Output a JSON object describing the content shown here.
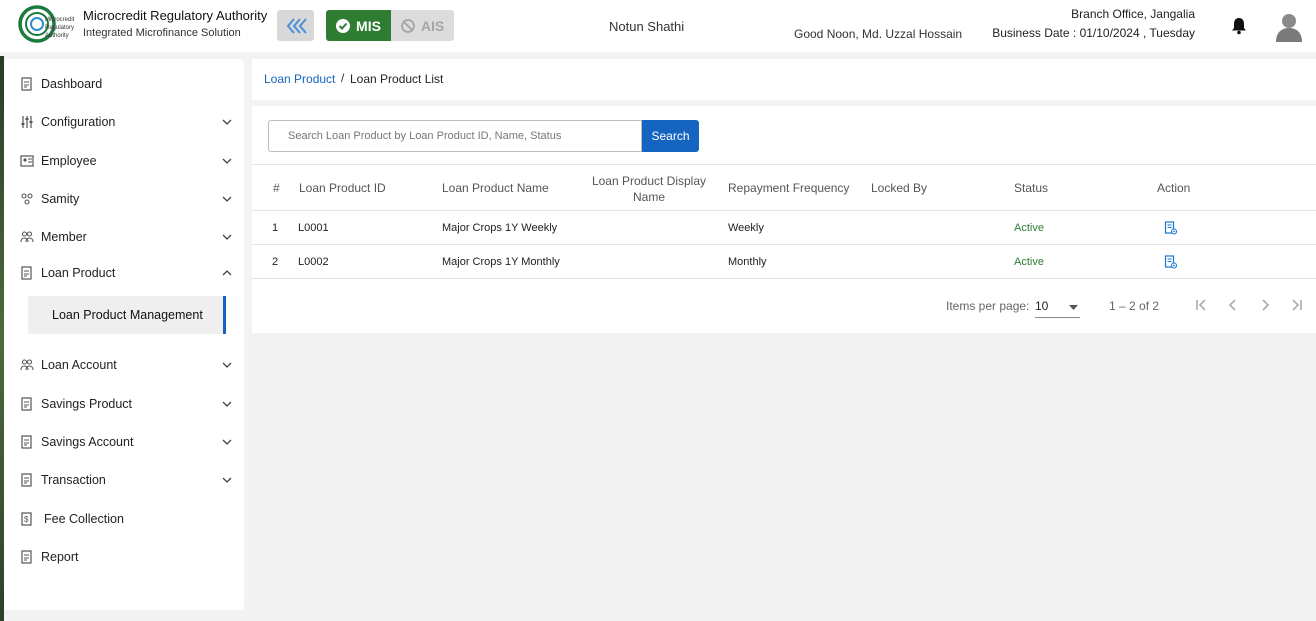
{
  "header": {
    "org_title": "Microcredit Regulatory Authority",
    "org_subtitle": "Integrated Microfinance Solution",
    "logo_text": "Microcredit Regulatory Authority",
    "mode_mis": "MIS",
    "mode_ais": "AIS",
    "center_title": "Notun Shathi",
    "greeting": "Good Noon, Md. Uzzal Hossain",
    "branch": "Branch Office, Jangalia",
    "business_date": "Business Date : 01/10/2024 , Tuesday",
    "accent_color": "#1565c0",
    "mis_color": "#2e7d32"
  },
  "sidebar": {
    "items": [
      {
        "label": "Dashboard",
        "icon": "document-icon"
      },
      {
        "label": "Configuration",
        "icon": "sliders-icon"
      },
      {
        "label": "Employee",
        "icon": "id-card-icon"
      },
      {
        "label": "Samity",
        "icon": "group-icon"
      },
      {
        "label": "Member",
        "icon": "users-icon"
      },
      {
        "label": "Loan Product",
        "icon": "document-icon"
      },
      {
        "label": "Loan Account",
        "icon": "users-icon"
      },
      {
        "label": "Savings Product",
        "icon": "document-icon"
      },
      {
        "label": "Savings Account",
        "icon": "document-icon"
      },
      {
        "label": "Transaction",
        "icon": "document-icon"
      },
      {
        "label": "Fee Collection",
        "icon": "fee-icon"
      },
      {
        "label": "Report",
        "icon": "document-icon"
      }
    ],
    "sub_item": "Loan Product Management"
  },
  "breadcrumb": {
    "parent": "Loan Product",
    "separator": "/",
    "current": "Loan Product List"
  },
  "search": {
    "placeholder": "Search Loan Product by Loan Product ID, Name, Status",
    "button_label": "Search"
  },
  "table": {
    "headers": {
      "index": "#",
      "id": "Loan Product ID",
      "name": "Loan Product Name",
      "display_name": "Loan Product Display Name",
      "frequency": "Repayment Frequency",
      "locked_by": "Locked By",
      "status": "Status",
      "action": "Action"
    },
    "rows": [
      {
        "index": "1",
        "id": "L0001",
        "name": "Major Crops 1Y Weekly",
        "display_name": "",
        "frequency": "Weekly",
        "locked_by": "",
        "status": "Active"
      },
      {
        "index": "2",
        "id": "L0002",
        "name": "Major Crops 1Y Monthly",
        "display_name": "",
        "frequency": "Monthly",
        "locked_by": "",
        "status": "Active"
      }
    ]
  },
  "paginator": {
    "items_label": "Items per page:",
    "page_size": "10",
    "range": "1 – 2 of 2"
  }
}
